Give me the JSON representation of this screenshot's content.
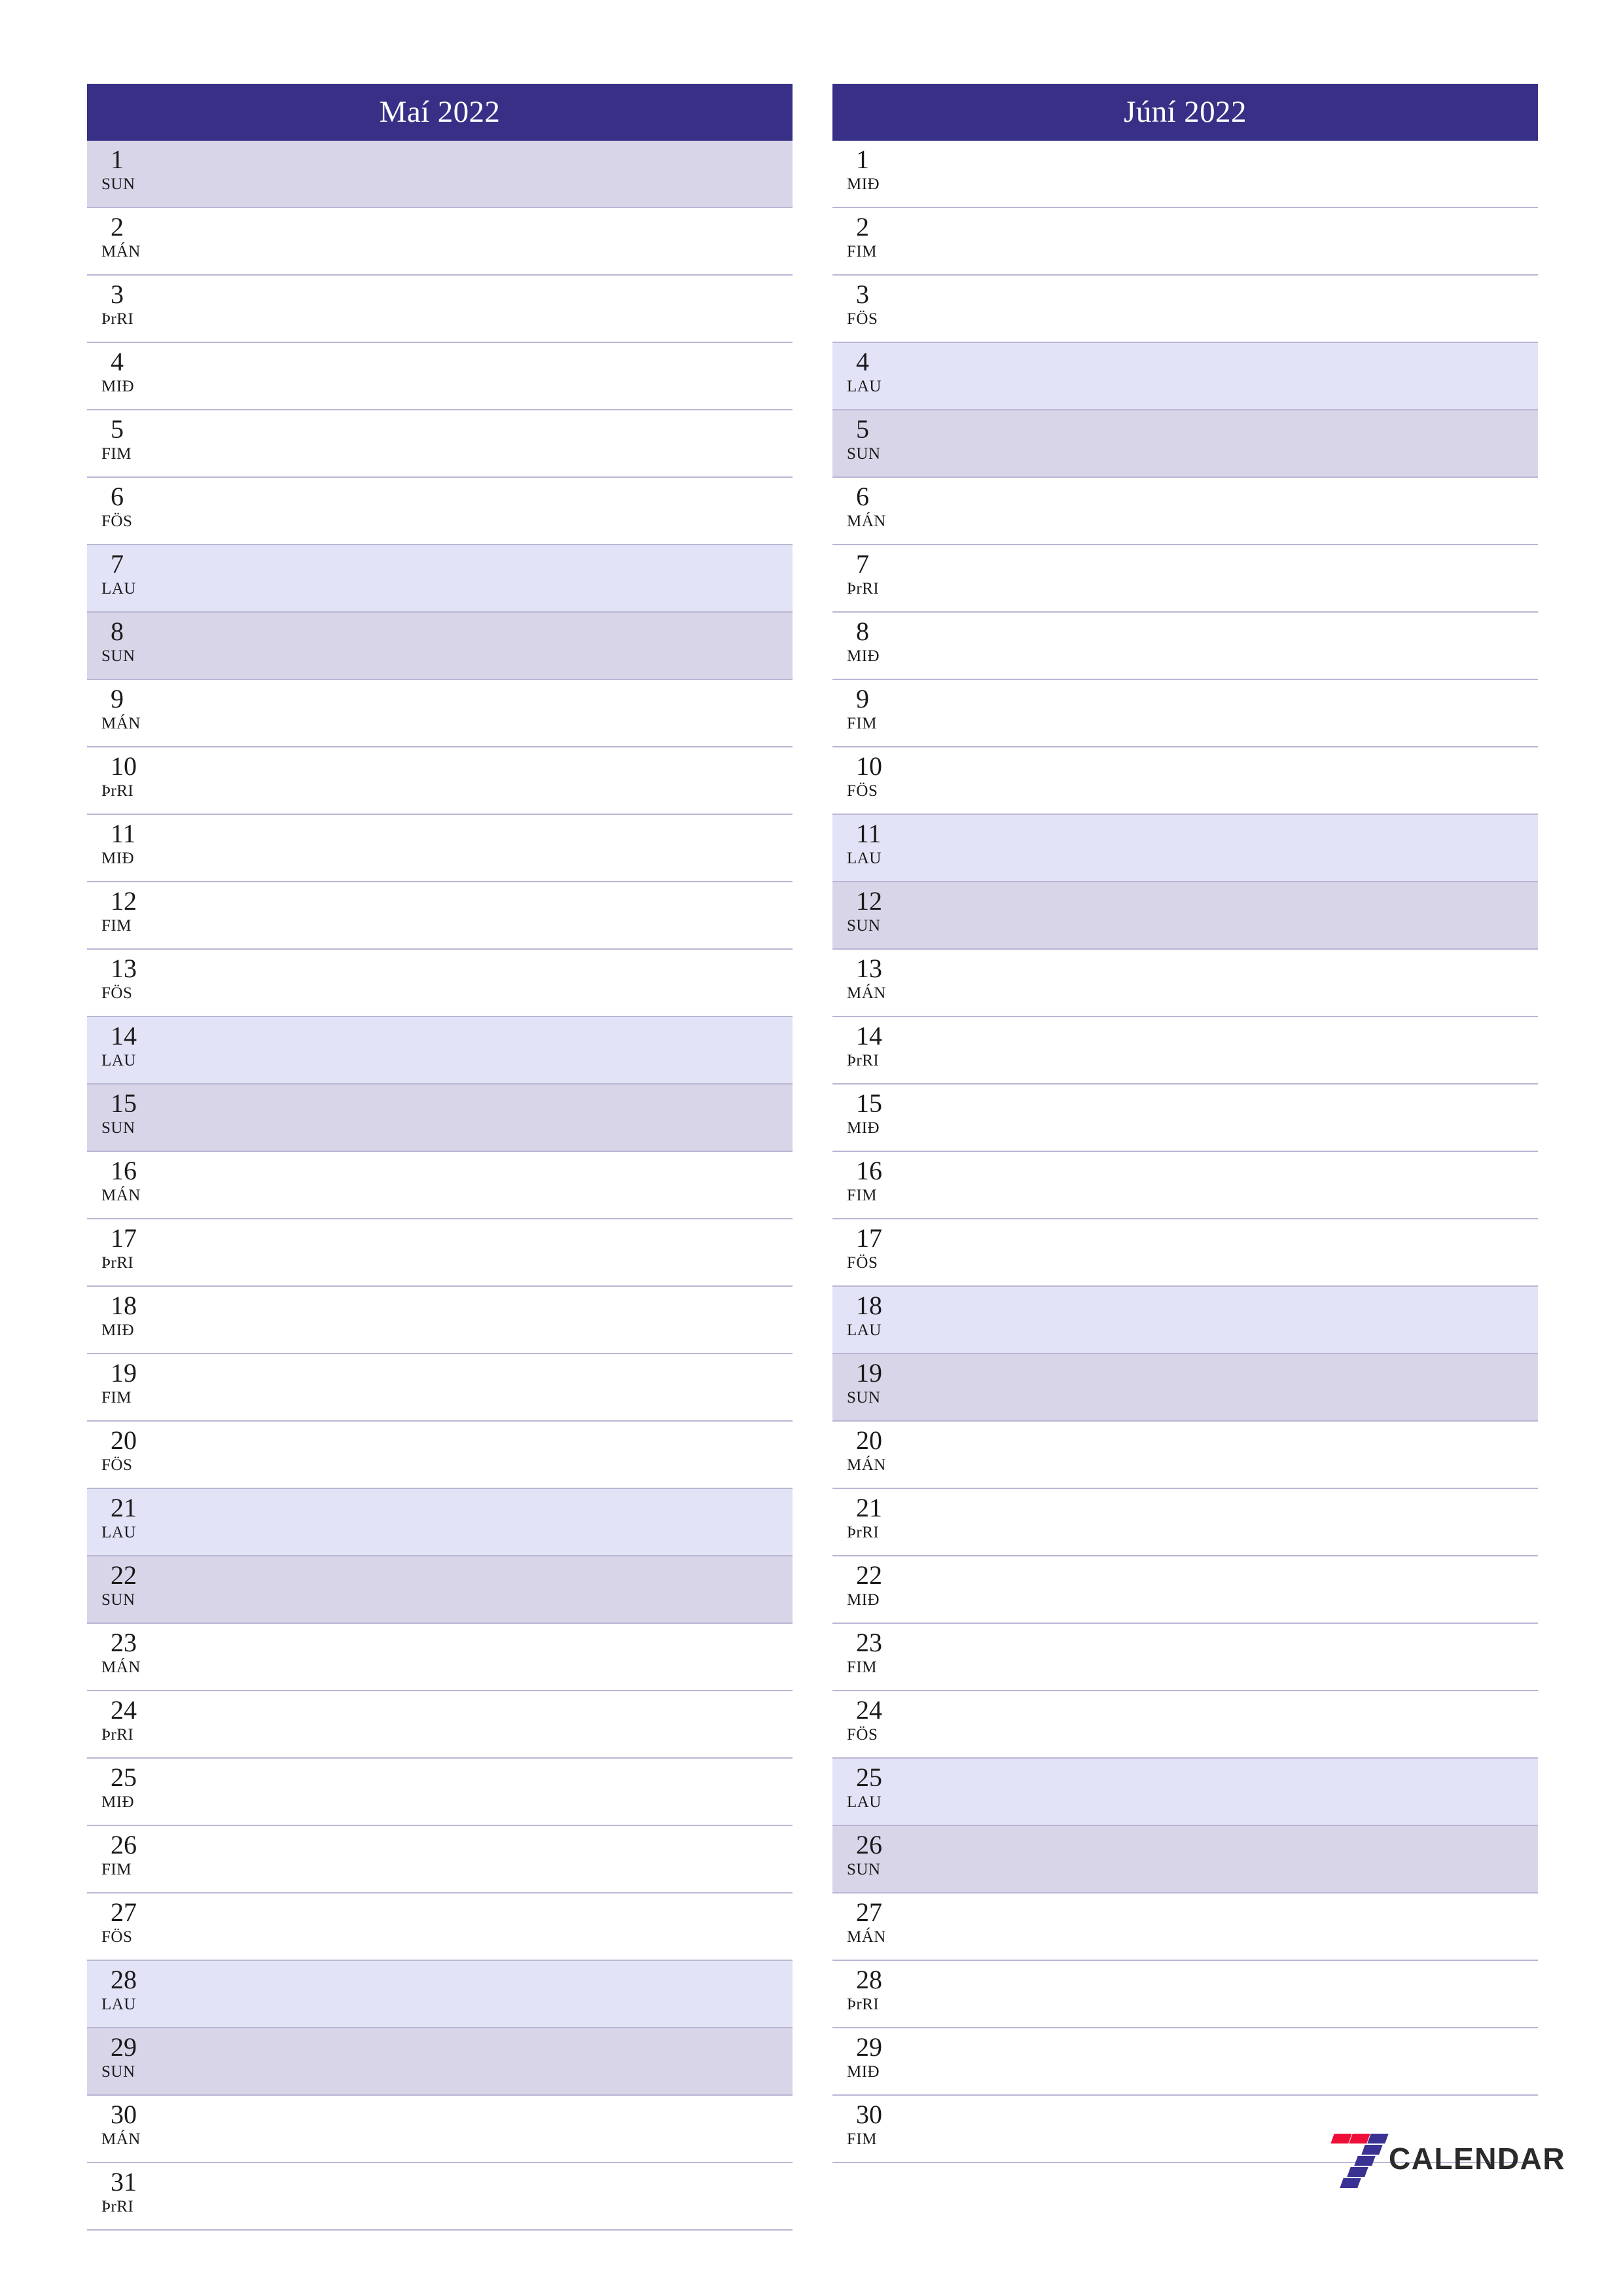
{
  "colors": {
    "header_bg": "#383087",
    "header_text": "#ffffff",
    "saturday_bg": "#e2e3f6",
    "sunday_bg": "#d9d5e9",
    "row_border": "#b9b6d4",
    "logo_red": "#ed0f38",
    "logo_blue": "#3a3293",
    "text": "#1a1a1a"
  },
  "months": [
    {
      "title": "Maí 2022",
      "days": [
        {
          "num": "1",
          "abbr": "SUN",
          "type": "sun"
        },
        {
          "num": "2",
          "abbr": "MÁN",
          "type": "weekday"
        },
        {
          "num": "3",
          "abbr": "ÞrRI",
          "type": "weekday"
        },
        {
          "num": "4",
          "abbr": "MIÐ",
          "type": "weekday"
        },
        {
          "num": "5",
          "abbr": "FIM",
          "type": "weekday"
        },
        {
          "num": "6",
          "abbr": "FÖS",
          "type": "weekday"
        },
        {
          "num": "7",
          "abbr": "LAU",
          "type": "sat"
        },
        {
          "num": "8",
          "abbr": "SUN",
          "type": "sun"
        },
        {
          "num": "9",
          "abbr": "MÁN",
          "type": "weekday"
        },
        {
          "num": "10",
          "abbr": "ÞrRI",
          "type": "weekday"
        },
        {
          "num": "11",
          "abbr": "MIÐ",
          "type": "weekday"
        },
        {
          "num": "12",
          "abbr": "FIM",
          "type": "weekday"
        },
        {
          "num": "13",
          "abbr": "FÖS",
          "type": "weekday"
        },
        {
          "num": "14",
          "abbr": "LAU",
          "type": "sat"
        },
        {
          "num": "15",
          "abbr": "SUN",
          "type": "sun"
        },
        {
          "num": "16",
          "abbr": "MÁN",
          "type": "weekday"
        },
        {
          "num": "17",
          "abbr": "ÞrRI",
          "type": "weekday"
        },
        {
          "num": "18",
          "abbr": "MIÐ",
          "type": "weekday"
        },
        {
          "num": "19",
          "abbr": "FIM",
          "type": "weekday"
        },
        {
          "num": "20",
          "abbr": "FÖS",
          "type": "weekday"
        },
        {
          "num": "21",
          "abbr": "LAU",
          "type": "sat"
        },
        {
          "num": "22",
          "abbr": "SUN",
          "type": "sun"
        },
        {
          "num": "23",
          "abbr": "MÁN",
          "type": "weekday"
        },
        {
          "num": "24",
          "abbr": "ÞrRI",
          "type": "weekday"
        },
        {
          "num": "25",
          "abbr": "MIÐ",
          "type": "weekday"
        },
        {
          "num": "26",
          "abbr": "FIM",
          "type": "weekday"
        },
        {
          "num": "27",
          "abbr": "FÖS",
          "type": "weekday"
        },
        {
          "num": "28",
          "abbr": "LAU",
          "type": "sat"
        },
        {
          "num": "29",
          "abbr": "SUN",
          "type": "sun"
        },
        {
          "num": "30",
          "abbr": "MÁN",
          "type": "weekday"
        },
        {
          "num": "31",
          "abbr": "ÞrRI",
          "type": "weekday"
        }
      ]
    },
    {
      "title": "Júní 2022",
      "days": [
        {
          "num": "1",
          "abbr": "MIÐ",
          "type": "weekday"
        },
        {
          "num": "2",
          "abbr": "FIM",
          "type": "weekday"
        },
        {
          "num": "3",
          "abbr": "FÖS",
          "type": "weekday"
        },
        {
          "num": "4",
          "abbr": "LAU",
          "type": "sat"
        },
        {
          "num": "5",
          "abbr": "SUN",
          "type": "sun"
        },
        {
          "num": "6",
          "abbr": "MÁN",
          "type": "weekday"
        },
        {
          "num": "7",
          "abbr": "ÞrRI",
          "type": "weekday"
        },
        {
          "num": "8",
          "abbr": "MIÐ",
          "type": "weekday"
        },
        {
          "num": "9",
          "abbr": "FIM",
          "type": "weekday"
        },
        {
          "num": "10",
          "abbr": "FÖS",
          "type": "weekday"
        },
        {
          "num": "11",
          "abbr": "LAU",
          "type": "sat"
        },
        {
          "num": "12",
          "abbr": "SUN",
          "type": "sun"
        },
        {
          "num": "13",
          "abbr": "MÁN",
          "type": "weekday"
        },
        {
          "num": "14",
          "abbr": "ÞrRI",
          "type": "weekday"
        },
        {
          "num": "15",
          "abbr": "MIÐ",
          "type": "weekday"
        },
        {
          "num": "16",
          "abbr": "FIM",
          "type": "weekday"
        },
        {
          "num": "17",
          "abbr": "FÖS",
          "type": "weekday"
        },
        {
          "num": "18",
          "abbr": "LAU",
          "type": "sat"
        },
        {
          "num": "19",
          "abbr": "SUN",
          "type": "sun"
        },
        {
          "num": "20",
          "abbr": "MÁN",
          "type": "weekday"
        },
        {
          "num": "21",
          "abbr": "ÞrRI",
          "type": "weekday"
        },
        {
          "num": "22",
          "abbr": "MIÐ",
          "type": "weekday"
        },
        {
          "num": "23",
          "abbr": "FIM",
          "type": "weekday"
        },
        {
          "num": "24",
          "abbr": "FÖS",
          "type": "weekday"
        },
        {
          "num": "25",
          "abbr": "LAU",
          "type": "sat"
        },
        {
          "num": "26",
          "abbr": "SUN",
          "type": "sun"
        },
        {
          "num": "27",
          "abbr": "MÁN",
          "type": "weekday"
        },
        {
          "num": "28",
          "abbr": "ÞrRI",
          "type": "weekday"
        },
        {
          "num": "29",
          "abbr": "MIÐ",
          "type": "weekday"
        },
        {
          "num": "30",
          "abbr": "FIM",
          "type": "weekday"
        }
      ]
    }
  ],
  "logo": {
    "icon": "seven-logo-icon",
    "text": "CALENDAR"
  }
}
